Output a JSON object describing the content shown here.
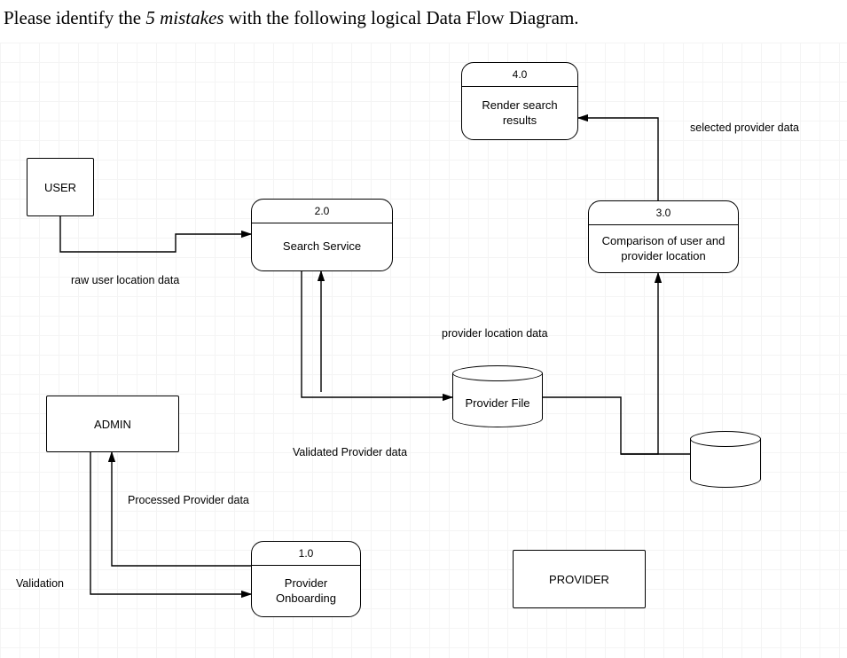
{
  "question": {
    "prefix": "Please identify the ",
    "emphasis": "5 mistakes",
    "suffix": " with the following logical Data Flow Diagram."
  },
  "entities": {
    "user": "USER",
    "admin": "ADMIN",
    "provider": "PROVIDER"
  },
  "processes": {
    "p1": {
      "id": "1.0",
      "name": "Provider Onboarding"
    },
    "p2": {
      "id": "2.0",
      "name": "Search Service"
    },
    "p3": {
      "id": "3.0",
      "name": "Comparison of user and provider location"
    },
    "p4": {
      "id": "4.0",
      "name": "Render search results"
    }
  },
  "datastores": {
    "providerFile": "Provider File",
    "unnamed": ""
  },
  "flows": {
    "rawUserLocation": "raw user location data",
    "validatedProvider": "Validated Provider data",
    "processedProvider": "Processed Provider data",
    "validation": "Validation",
    "providerLocation": "provider location data",
    "selectedProvider": "selected provider data"
  }
}
